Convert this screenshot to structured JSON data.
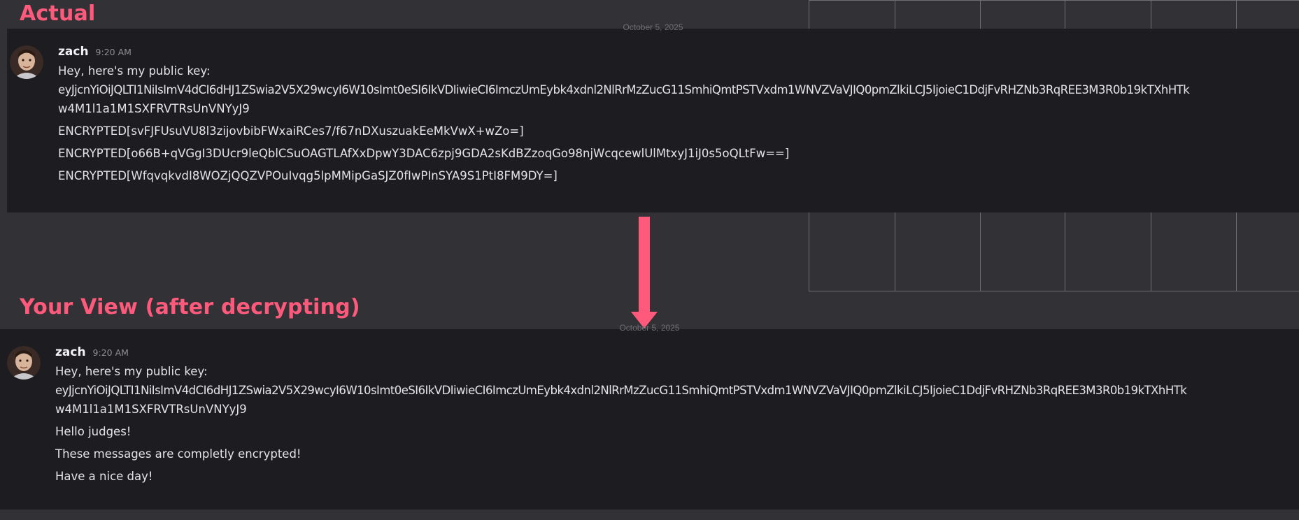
{
  "labels": {
    "actual": "Actual",
    "decrypted_view": "Your View (after decrypting)"
  },
  "colors": {
    "accent": "#ff5a7c",
    "panel_bg": "#1d1d21",
    "page_bg": "#323236"
  },
  "top_panel": {
    "date": "October 5, 2025",
    "message": {
      "username": "zach",
      "time": "9:20 AM",
      "intro": "Hey, here's my public key:",
      "key_line1": "eyJjcnYiOiJQLTI1NiIsImV4dCI6dHJ1ZSwia2V5X29wcyI6W10sImt0eSI6IkVDIiwieCI6ImczUmEybk4xdnl2NlRrMzZucG11SmhiQmtPSTVxdm1WNVZVaVJIQ0pmZlkiLCJ5IjoieC1DdjFvRHZNb3RqREE3M3R0b19kTXhHTk",
      "key_line2": "w4M1l1a1M1SXFRVTRsUnVNYyJ9",
      "lines": [
        "ENCRYPTED[svFJFUsuVU8l3zijovbibFWxaiRCes7/f67nDXuszuakEeMkVwX+wZo=]",
        "ENCRYPTED[o66B+qVGgI3DUcr9leQblCSuOAGTLAfXxDpwY3DAC6zpj9GDA2sKdBZzoqGo98njWcqcewlUlMtxyJ1iJ0s5oQLtFw==]",
        "ENCRYPTED[WfqvqkvdI8WOZjQQZVPOuIvqg5lpMMipGaSJZ0fIwPInSYA9S1PtI8FM9DY=]"
      ]
    }
  },
  "bottom_panel": {
    "date": "October 5, 2025",
    "message": {
      "username": "zach",
      "time": "9:20 AM",
      "intro": "Hey, here's my public key:",
      "key_line1": "eyJjcnYiOiJQLTI1NiIsImV4dCI6dHJ1ZSwia2V5X29wcyI6W10sImt0eSI6IkVDIiwieCI6ImczUmEybk4xdnl2NlRrMzZucG11SmhiQmtPSTVxdm1WNVZVaVJIQ0pmZlkiLCJ5IjoieC1DdjFvRHZNb3RqREE3M3R0b19kTXhHTk",
      "key_line2": "w4M1l1a1M1SXFRVTRsUnVNYyJ9",
      "lines": [
        "Hello judges!",
        "These messages are completly encrypted!",
        "Have a nice day!"
      ]
    }
  }
}
